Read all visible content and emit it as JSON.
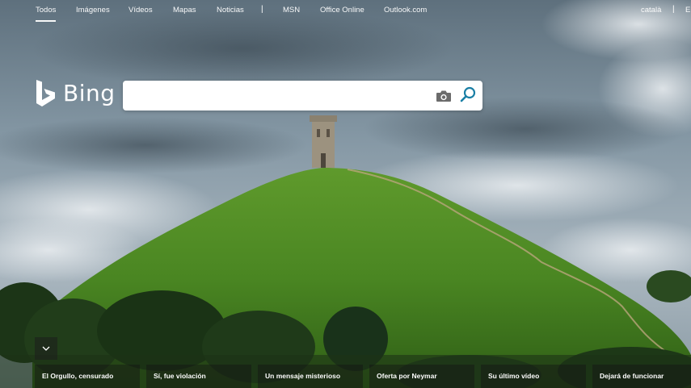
{
  "nav": {
    "items": [
      {
        "label": "Todos",
        "active": true
      },
      {
        "label": "Imágenes"
      },
      {
        "label": "Vídeos"
      },
      {
        "label": "Mapas"
      },
      {
        "label": "Noticias"
      },
      {
        "label": "MSN"
      },
      {
        "label": "Office Online"
      },
      {
        "label": "Outlook.com"
      }
    ],
    "separator": "|",
    "language": "català",
    "right_separator": "|",
    "right_partial": "E"
  },
  "logo": {
    "text": "Bing",
    "icon": "bing-b-icon"
  },
  "search": {
    "value": "",
    "placeholder": "",
    "camera_icon": "camera-icon",
    "search_icon": "search-icon"
  },
  "expand": {
    "icon": "chevron-down-icon"
  },
  "news": [
    {
      "label": "El Orgullo, censurado"
    },
    {
      "label": "Sí, fue violación"
    },
    {
      "label": "Un mensaje misterioso"
    },
    {
      "label": "Oferta por Neymar"
    },
    {
      "label": "Su último vídeo"
    },
    {
      "label": "Dejará de funcionar"
    }
  ],
  "colors": {
    "accent": "#1a7fa5",
    "text_on_image": "#ffffff",
    "tile_background": "#141414"
  }
}
